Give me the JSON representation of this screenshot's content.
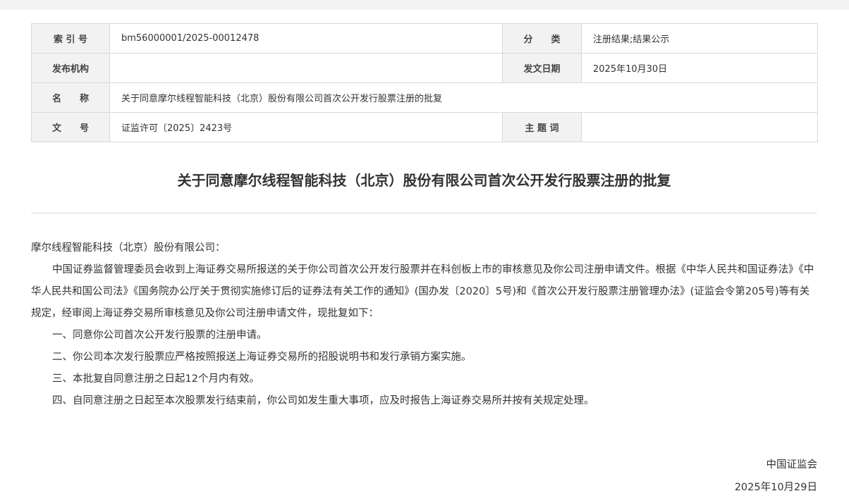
{
  "meta": {
    "index_label": "索 引 号",
    "index_value": "bm56000001/2025-00012478",
    "category_label": "分　　类",
    "category_value": "注册结果;结果公示",
    "issuer_label": "发布机构",
    "issuer_value": "",
    "date_label": "发文日期",
    "date_value": "2025年10月30日",
    "name_label": "名　　称",
    "name_value": "关于同意摩尔线程智能科技（北京）股份有限公司首次公开发行股票注册的批复",
    "docno_label": "文　　号",
    "docno_value": "证监许可〔2025〕2423号",
    "keywords_label": "主 题 词",
    "keywords_value": ""
  },
  "document": {
    "title": "关于同意摩尔线程智能科技（北京）股份有限公司首次公开发行股票注册的批复",
    "salutation": "摩尔线程智能科技（北京）股份有限公司：",
    "paragraph_intro": "中国证券监督管理委员会收到上海证券交易所报送的关于你公司首次公开发行股票并在科创板上市的审核意见及你公司注册申请文件。根据《中华人民共和国证券法》《中华人民共和国公司法》《国务院办公厅关于贯彻实施修订后的证券法有关工作的通知》(国办发〔2020〕5号)和《首次公开发行股票注册管理办法》(证监会令第205号)等有关规定，经审阅上海证券交易所审核意见及你公司注册申请文件，现批复如下：",
    "items": [
      "一、同意你公司首次公开发行股票的注册申请。",
      "二、你公司本次发行股票应严格按照报送上海证券交易所的招股说明书和发行承销方案实施。",
      "三、本批复自同意注册之日起12个月内有效。",
      "四、自同意注册之日起至本次股票发行结束前，你公司如发生重大事项，应及时报告上海证券交易所并按有关规定处理。"
    ],
    "signature_org": "中国证监会",
    "signature_date": "2025年10月29日"
  }
}
